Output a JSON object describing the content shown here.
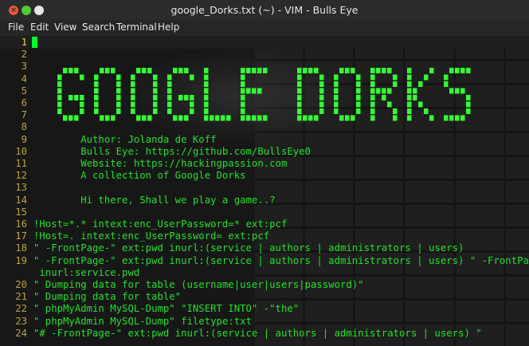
{
  "window": {
    "title": "google_Dorks.txt (~) - VIM - Bulls Eye",
    "close_glyph": "×",
    "min_glyph": "",
    "max_glyph": ""
  },
  "menu": [
    "File",
    "Edit",
    "View",
    "Search",
    "Terminal",
    "Help"
  ],
  "logo": {
    "text": "GOOGLE DORKS",
    "color": "#33ff33"
  },
  "lines": [
    {
      "n": "1",
      "t": ""
    },
    {
      "n": "2",
      "t": ""
    },
    {
      "n": "3",
      "t": ""
    },
    {
      "n": "4",
      "t": ""
    },
    {
      "n": "5",
      "t": ""
    },
    {
      "n": "6",
      "t": ""
    },
    {
      "n": "7",
      "t": ""
    },
    {
      "n": "8",
      "t": ""
    },
    {
      "n": "9",
      "t": "        Author: Jolanda de Koff"
    },
    {
      "n": "10",
      "t": "        Bulls Eye: https://github.com/BullsEye0"
    },
    {
      "n": "11",
      "t": "        Website: https://hackingpassion.com"
    },
    {
      "n": "12",
      "t": "        A collection of Google Dorks"
    },
    {
      "n": "13",
      "t": ""
    },
    {
      "n": "14",
      "t": "        Hi there, Shall we play a game..?"
    },
    {
      "n": "15",
      "t": ""
    },
    {
      "n": "16",
      "t": "!Host=*.* intext:enc_UserPassword=* ext:pcf"
    },
    {
      "n": "17",
      "t": "!Host=. intext:enc_UserPassword= ext:pcf"
    },
    {
      "n": "18",
      "t": "\" -FrontPage-\" ext:pwd inurl:(service | authors | administrators | users)"
    },
    {
      "n": "19",
      "t": "\" -FrontPage-\" ext:pwd inurl:(service | authors | administrators | users) \" -FrontPage-\""
    },
    {
      "n": "",
      "t": " inurl:service.pwd"
    },
    {
      "n": "20",
      "t": "\" Dumping data for table (username|user|users|password)\""
    },
    {
      "n": "21",
      "t": "\" Dumping data for table\""
    },
    {
      "n": "22",
      "t": "\" phpMyAdmin MySQL-Dump\" \"INSERT INTO\" -\"the\""
    },
    {
      "n": "23",
      "t": "\" phpMyAdmin MySQL-Dump\" filetype:txt"
    },
    {
      "n": "24",
      "t": "\"# -FrontPage-\" ext:pwd inurl:(service | authors | administrators | users) \""
    }
  ]
}
